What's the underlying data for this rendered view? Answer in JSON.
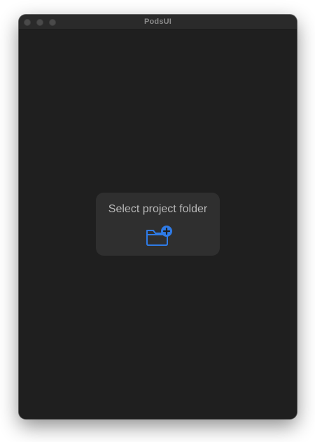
{
  "window": {
    "title": "PodsUI",
    "controls": [
      "close",
      "minimize",
      "zoom"
    ]
  },
  "main": {
    "select_folder_label": "Select project folder",
    "select_folder_icon": "folder-plus-icon"
  },
  "colors": {
    "window_bg": "#1f1f1f",
    "card_bg": "#2f2f2f",
    "accent": "#2f7be6",
    "label": "#b9b9b9"
  }
}
